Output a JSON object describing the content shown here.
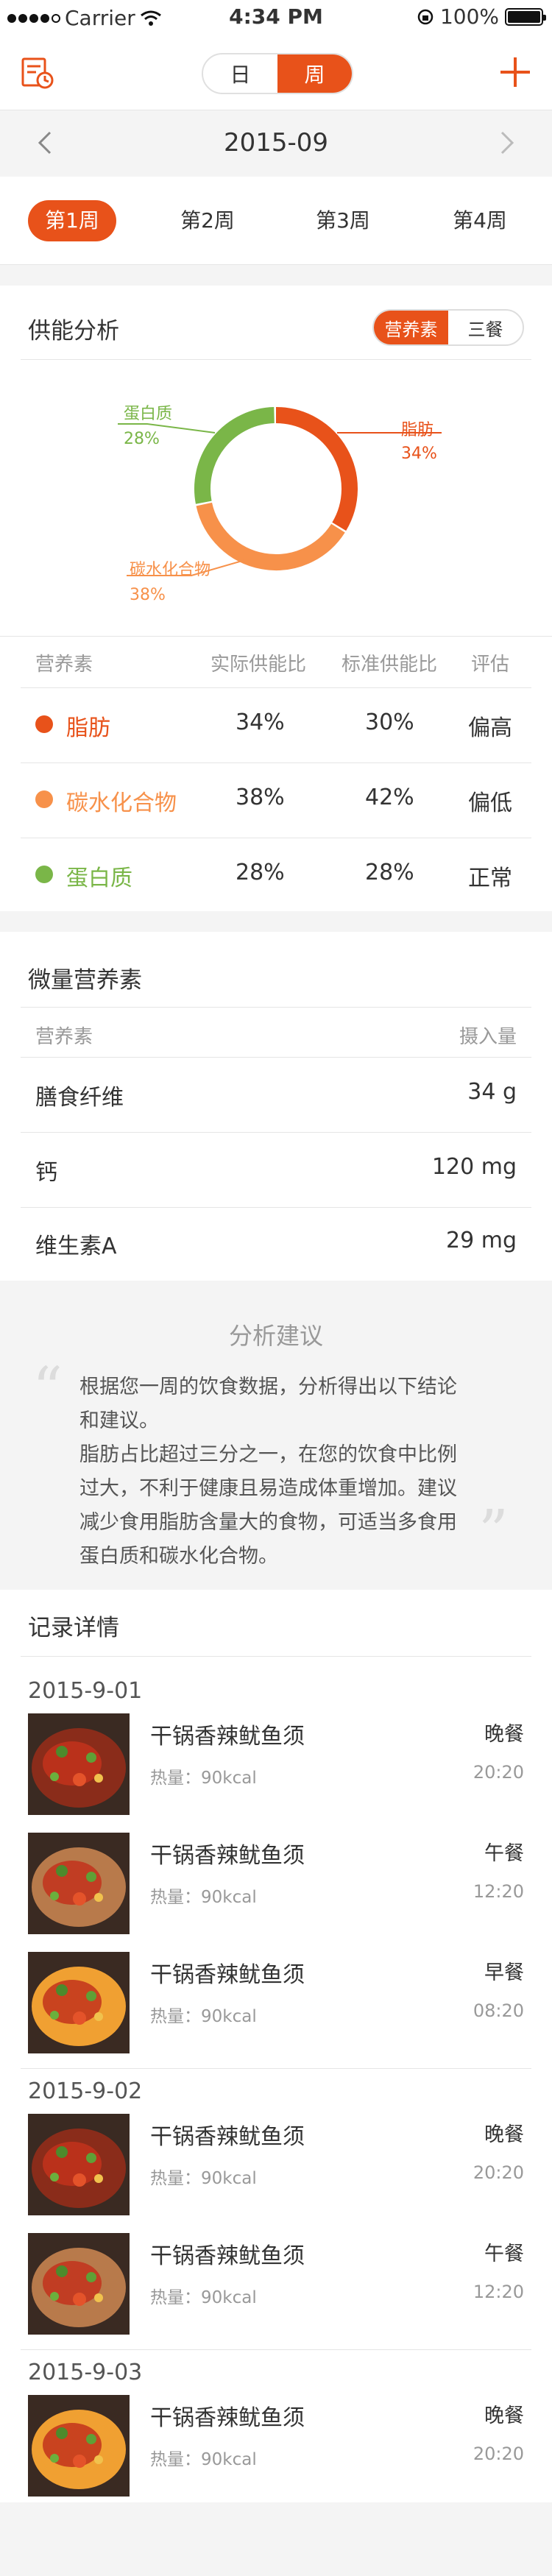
{
  "status_bar": {
    "carrier": "Carrier",
    "time": "4:34 PM",
    "battery": "100%"
  },
  "nav": {
    "seg_day": "日",
    "seg_week": "周"
  },
  "month": {
    "label": "2015-09"
  },
  "weeks": [
    "第1周",
    "第2周",
    "第3周",
    "第4周"
  ],
  "energy": {
    "title": "供能分析",
    "toggle_nutrients": "营养素",
    "toggle_meals": "三餐",
    "chart_labels": {
      "fat_name": "脂肪",
      "fat_pct": "34%",
      "carb_name": "碳水化合物",
      "carb_pct": "38%",
      "protein_name": "蛋白质",
      "protein_pct": "28%"
    },
    "table_headers": [
      "营养素",
      "实际供能比",
      "标准供能比",
      "评估"
    ],
    "rows": [
      {
        "name": "脂肪",
        "actual": "34%",
        "standard": "30%",
        "eval": "偏高"
      },
      {
        "name": "碳水化合物",
        "actual": "38%",
        "standard": "42%",
        "eval": "偏低"
      },
      {
        "name": "蛋白质",
        "actual": "28%",
        "standard": "28%",
        "eval": "正常"
      }
    ]
  },
  "chart_data": {
    "type": "pie",
    "categories": [
      "脂肪",
      "碳水化合物",
      "蛋白质"
    ],
    "values": [
      34,
      38,
      28
    ],
    "colors": [
      "#e8521a",
      "#f7914a",
      "#7ab648"
    ]
  },
  "micro": {
    "title": "微量营养素",
    "header_name": "营养素",
    "header_amount": "摄入量",
    "rows": [
      {
        "name": "膳食纤维",
        "amount": "34 g"
      },
      {
        "name": "钙",
        "amount": "120 mg"
      },
      {
        "name": "维生素A",
        "amount": "29 mg"
      }
    ]
  },
  "advice": {
    "title": "分析建议",
    "line1": "根据您一周的饮食数据，分析得出以下结论",
    "line2": "和建议。",
    "line3": "脂肪占比超过三分之一，在您的饮食中比例",
    "line4": "过大，不利于健康且易造成体重增加。建议",
    "line5": "减少食用脂肪含量大的食物，可适当多食用",
    "line6": "蛋白质和碳水化合物。"
  },
  "records": {
    "title": "记录详情",
    "days": [
      {
        "date": "2015-9-01",
        "items": [
          {
            "name": "干锅香辣鱿鱼须",
            "cal": "热量：90kcal",
            "meal": "晚餐",
            "time": "20:20"
          },
          {
            "name": "干锅香辣鱿鱼须",
            "cal": "热量：90kcal",
            "meal": "午餐",
            "time": "12:20"
          },
          {
            "name": "干锅香辣鱿鱼须",
            "cal": "热量：90kcal",
            "meal": "早餐",
            "time": "08:20"
          }
        ]
      },
      {
        "date": "2015-9-02",
        "items": [
          {
            "name": "干锅香辣鱿鱼须",
            "cal": "热量：90kcal",
            "meal": "晚餐",
            "time": "20:20"
          },
          {
            "name": "干锅香辣鱿鱼须",
            "cal": "热量：90kcal",
            "meal": "午餐",
            "time": "12:20"
          }
        ]
      },
      {
        "date": "2015-9-03",
        "items": [
          {
            "name": "干锅香辣鱿鱼须",
            "cal": "热量：90kcal",
            "meal": "晚餐",
            "time": "20:20"
          }
        ]
      }
    ]
  },
  "colors": {
    "accent": "#e8521a",
    "orange": "#f7914a",
    "green": "#7ab648"
  }
}
